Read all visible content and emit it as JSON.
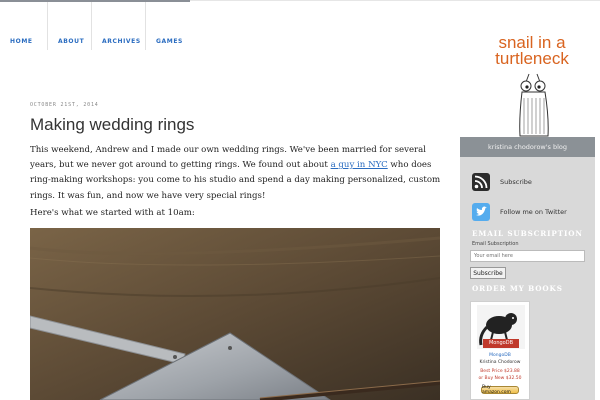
{
  "nav": {
    "items": [
      "HOME",
      "ABOUT",
      "ARCHIVES",
      "GAMES"
    ]
  },
  "post": {
    "date": "OCTOBER 21ST, 2014",
    "title": "Making wedding rings",
    "body_before_link": "This weekend, Andrew and I made our own wedding rings. We've been married for several years, but we never got around to getting rings. We found out about ",
    "link_text": "a guy in NYC",
    "body_after_link": " who does ring-making workshops: you come to his studio and spend a day making personalized, custom rings. It was fun, and now we have very special rings!",
    "paragraph2": "Here's what we started with at 10am:"
  },
  "sidebar": {
    "logo_line1": "snail in a",
    "logo_line2": "turtleneck",
    "tagline": "kristina chodorow's blog",
    "subscribe_label": "Subscribe",
    "twitter_label": "Follow me on Twitter",
    "email_heading": "EMAIL SUBSCRIPTION",
    "email_field_label": "Email Subscription",
    "email_placeholder": "Your email here",
    "subscribe_button": "Subscribe",
    "books_heading": "ORDER MY BOOKS",
    "book": {
      "cover_text": "MongoDB",
      "title": "MongoDB",
      "author": "Kristina Chodorow",
      "best_price": "Best Price $23.88",
      "buy_new": "or Buy New $32.50",
      "buy_button": "Buy amazon.com"
    }
  },
  "colors": {
    "accent_link": "#2a6cc0",
    "logo_orange": "#d96420",
    "sidebar_bg": "#d9d9d9",
    "tagline_bg": "#8b9196"
  }
}
